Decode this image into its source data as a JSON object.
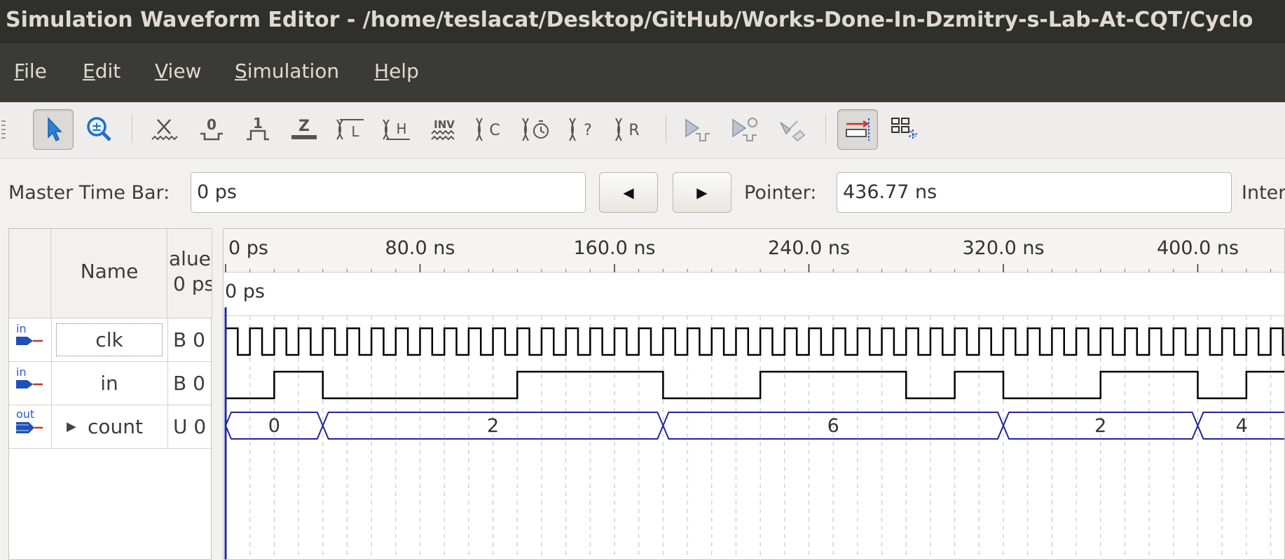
{
  "window": {
    "title": "Simulation Waveform Editor - /home/teslacat/Desktop/GitHub/Works-Done-In-Dzmitry-s-Lab-At-CQT/Cyclo"
  },
  "menu": [
    {
      "label": "File",
      "mnemonic": "F",
      "rest": "ile"
    },
    {
      "label": "Edit",
      "mnemonic": "E",
      "rest": "dit"
    },
    {
      "label": "View",
      "mnemonic": "V",
      "rest": "iew"
    },
    {
      "label": "Simulation",
      "mnemonic": "S",
      "rest": "imulation"
    },
    {
      "label": "Help",
      "mnemonic": "H",
      "rest": "elp"
    }
  ],
  "toolbar": {
    "icons": [
      "selection-tool-icon",
      "zoom-tool-icon",
      "forcing-unknown-icon",
      "forcing-low-icon",
      "forcing-high-icon",
      "high-impedance-icon",
      "weak-low-icon",
      "weak-high-icon",
      "invert-icon",
      "count-value-icon",
      "clock-overwrite-icon",
      "random-value-icon",
      "arbitrary-value-icon",
      "run-functional-simulation-icon",
      "run-timing-simulation-icon",
      "generate-netlist-icon",
      "snap-to-grid-icon",
      "group-icon"
    ],
    "labels": {
      "zeta": "Z",
      "xl": "L",
      "xh": "H",
      "inv": "INV",
      "xc": "C",
      "xq": "?",
      "xr": "R",
      "zero": "0",
      "one": "1"
    }
  },
  "timebar": {
    "master_label": "Master Time Bar:",
    "master_value": "0 ps",
    "pointer_label": "Pointer:",
    "pointer_value": "436.77 ns",
    "interval_label": "Inter"
  },
  "signals_table": {
    "headers": {
      "name": "Name",
      "value": "alue",
      "value_at": "0 ps"
    },
    "rows": [
      {
        "dir": "in",
        "name": "clk",
        "value": "B 0"
      },
      {
        "dir": "in",
        "name": "in",
        "value": "B 0"
      },
      {
        "dir": "out",
        "name": "count",
        "value": "U 0",
        "expandable": true
      }
    ]
  },
  "waveform": {
    "time_ticks": [
      "0 ps",
      "80.0 ns",
      "160.0 ns",
      "240.0 ns",
      "320.0 ns",
      "400.0 ns"
    ],
    "cursor_label": "0 ps",
    "count_values": [
      "0",
      "2",
      "6",
      "2",
      "4"
    ]
  },
  "colors": {
    "titlebar": "#2f2f2b",
    "menubar": "#3a3a36",
    "waveform_line": "#000000",
    "bus_line": "#23239a",
    "cursor": "#1e2aa8"
  }
}
